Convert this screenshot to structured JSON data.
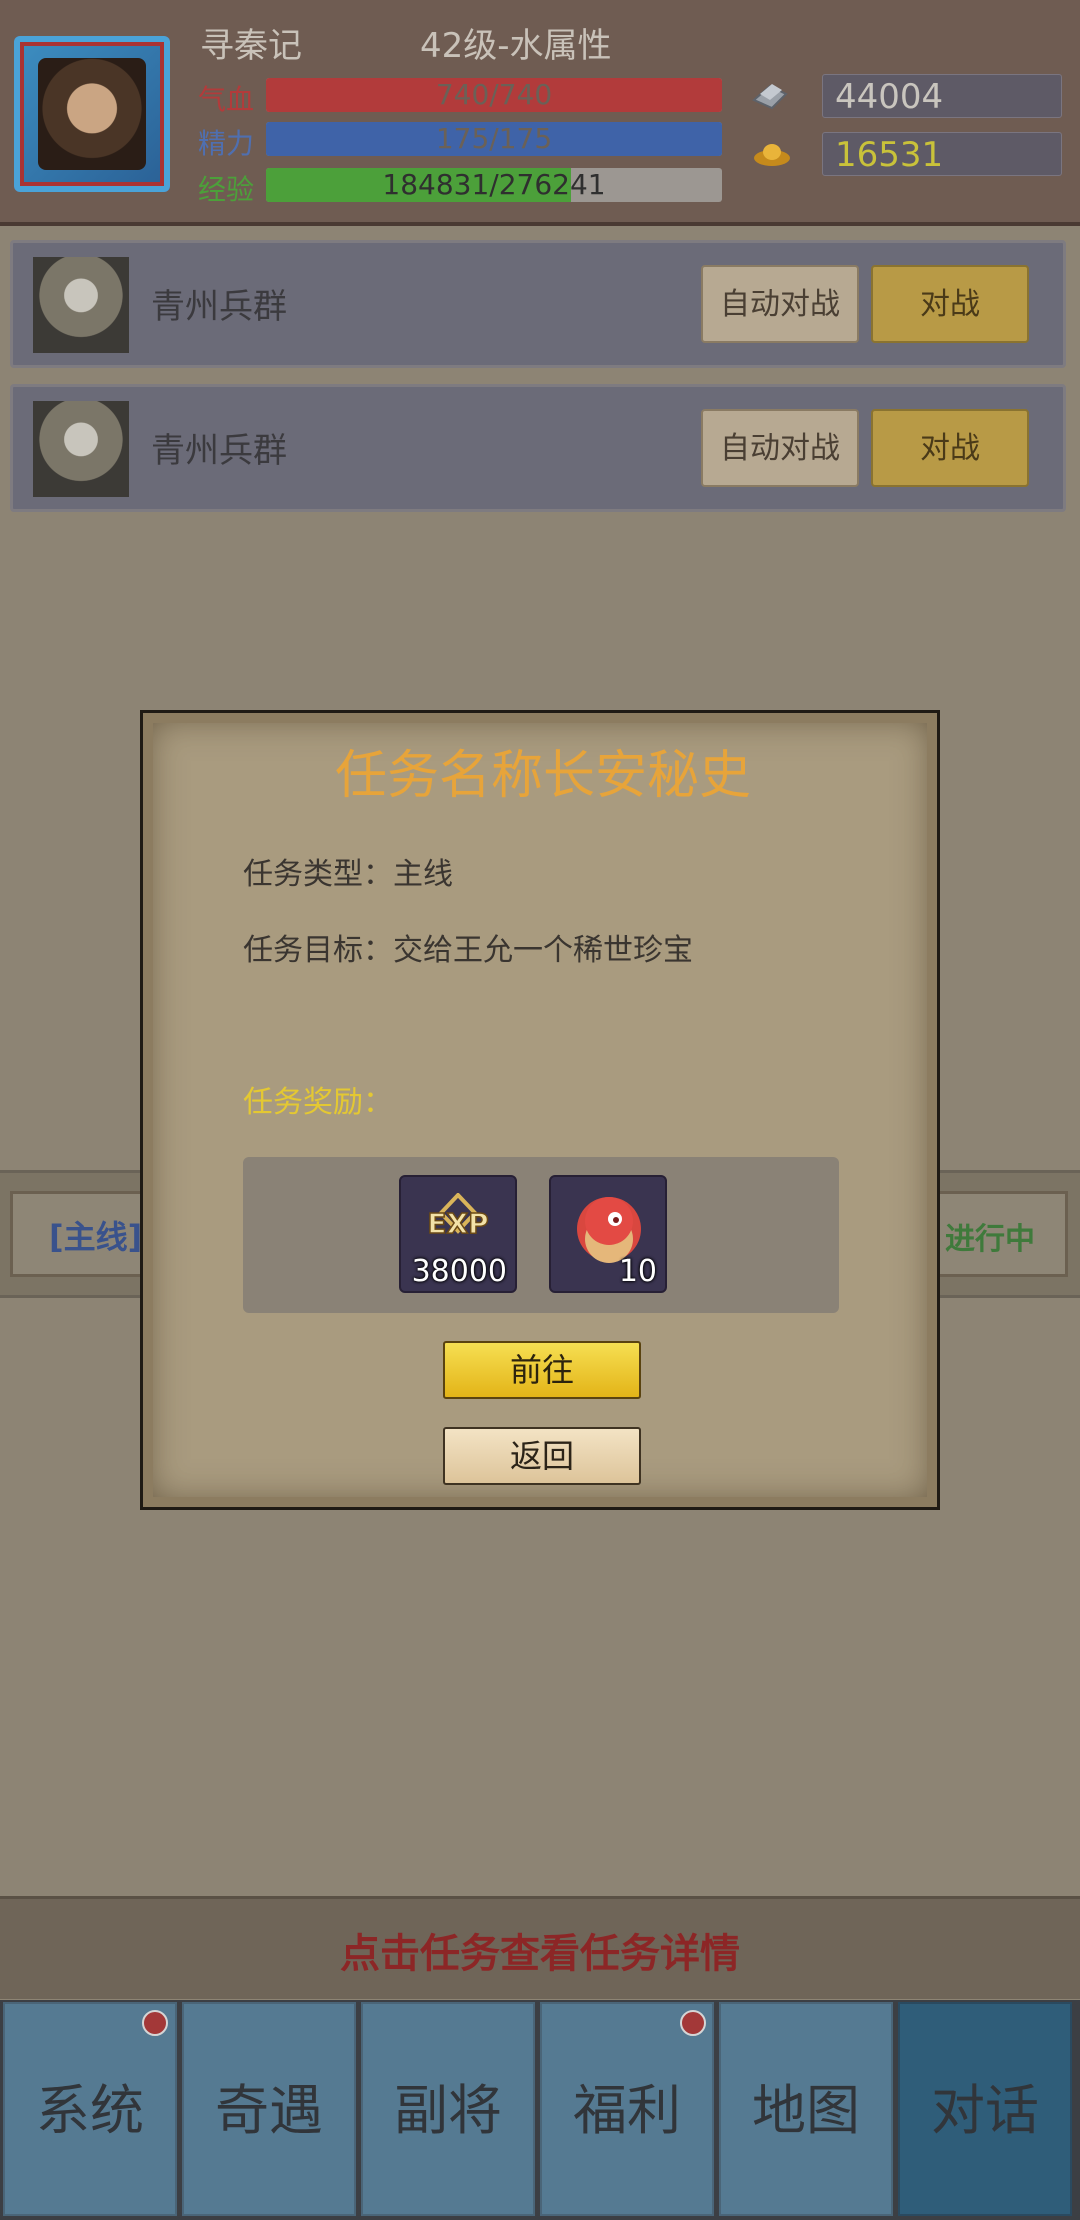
{
  "header": {
    "player_name": "寻秦记",
    "level_text": "42级-水属性",
    "hp": {
      "label": "气血",
      "text": "740/740",
      "fraction": 1.0,
      "color": "#b23b3b"
    },
    "mp": {
      "label": "精力",
      "text": "175/175",
      "fraction": 1.0,
      "color": "#3f63a8"
    },
    "exp": {
      "label": "经验",
      "text": "184831/276241",
      "fraction": 0.669,
      "color": "#4ca03a"
    },
    "silver": {
      "icon": "silver-ingot-icon",
      "value": "44004",
      "color": "#c9c5be"
    },
    "gold": {
      "icon": "gold-ingot-icon",
      "value": "16531",
      "color": "#c9c23a"
    }
  },
  "enemies": [
    {
      "name": "青州兵群",
      "auto_label": "自动对战",
      "fight_label": "对战"
    },
    {
      "name": "青州兵群",
      "auto_label": "自动对战",
      "fight_label": "对战"
    }
  ],
  "quest_strip": {
    "tag": "[主线]",
    "status": "进行中"
  },
  "dialog": {
    "title": "任务名称长安秘史",
    "type_label": "任务类型：",
    "type_value": "主线",
    "target_label": "任务目标：",
    "target_value": "交给王允一个稀世珍宝",
    "reward_label": "任务奖励：",
    "rewards": [
      {
        "icon": "exp-icon",
        "qty": "38000"
      },
      {
        "icon": "peach-item-icon",
        "qty": "10"
      }
    ],
    "goto_label": "前往",
    "back_label": "返回"
  },
  "hint": "点击任务查看任务详情",
  "nav": [
    {
      "label": "系统",
      "dot": true
    },
    {
      "label": "奇遇",
      "dot": false
    },
    {
      "label": "副将",
      "dot": false
    },
    {
      "label": "福利",
      "dot": true
    },
    {
      "label": "地图",
      "dot": false
    },
    {
      "label": "对话",
      "dot": false
    }
  ]
}
